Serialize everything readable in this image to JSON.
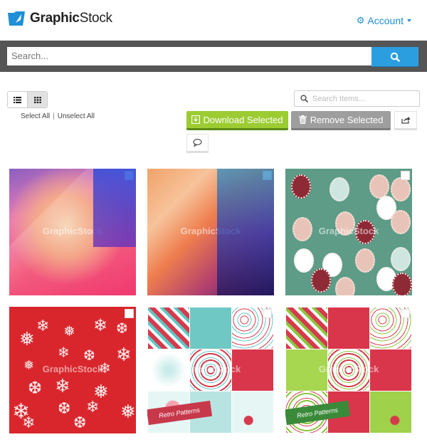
{
  "header": {
    "logo_text_bold": "Graphic",
    "logo_text_rest": "Stock",
    "logo_icon": "folder-rocket-icon",
    "account_label": "Account",
    "account_icon": "gear-icon"
  },
  "search": {
    "placeholder": "Search...",
    "value": "",
    "button_icon": "search-icon"
  },
  "toolbar": {
    "view_list_icon": "list-view-icon",
    "view_grid_icon": "grid-view-icon",
    "active_view": "grid",
    "select_all": "Select All",
    "separator": "|",
    "unselect_all": "Unselect All",
    "items_search_placeholder": "Search Items...",
    "download_label": "Download Selected",
    "remove_label": "Remove Selected",
    "share_icon": "share-icon",
    "comment_icon": "comment-icon"
  },
  "colors": {
    "accent_blue": "#2b9ee0",
    "download_green": "#9ccc32",
    "remove_gray": "#9e9e9e",
    "searchbar_bg": "#555555"
  },
  "items": [
    {
      "description": "Purple-pink-blue low poly geometric background",
      "watermark": "GraphicStock",
      "selected": false
    },
    {
      "description": "Orange-blue-purple low poly geometric background",
      "watermark": "GraphicStock",
      "selected": false
    },
    {
      "description": "Green pattern with mitten ornaments",
      "watermark": "GraphicStock",
      "selected": false
    },
    {
      "description": "Red background with white snowflakes",
      "watermark": "GraphicStock",
      "selected": false
    },
    {
      "description": "Retro Christmas patterns set - teal and red",
      "watermark": "GraphicStock",
      "banner": "Retro Patterns",
      "selected": false
    },
    {
      "description": "Retro Christmas patterns set - green and red",
      "watermark": "GraphicStock",
      "banner": "Retro Patterns",
      "selected": false
    }
  ]
}
